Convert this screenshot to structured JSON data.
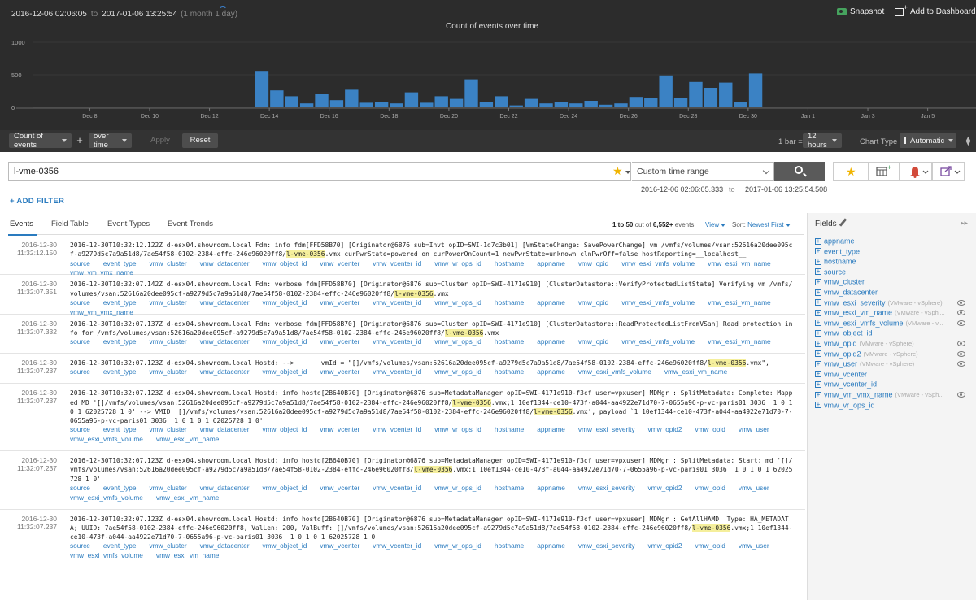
{
  "header": {
    "time_from": "2016-12-06   02:06:05",
    "to_word": "to",
    "time_to": "2017-01-06   13:25:54",
    "duration": "(1 month 1 day)",
    "snapshot_label": "Snapshot",
    "add_dashboard_label": "Add to Dashboard"
  },
  "chart_data": {
    "type": "bar",
    "title": "Count of events over time",
    "xlabel": "",
    "ylabel": "",
    "ylim": [
      0,
      1000
    ],
    "yticks": [
      "0",
      "500",
      "1000"
    ],
    "xticks": [
      "Dec 8",
      "Dec 10",
      "Dec 12",
      "Dec 14",
      "Dec 16",
      "Dec 18",
      "Dec 20",
      "Dec 22",
      "Dec 24",
      "Dec 26",
      "Dec 28",
      "Dec 30",
      "Jan 1",
      "Jan 3",
      "Jan 5"
    ],
    "xlim": [
      "2016-12-06 02:06",
      "2017-01-06 13:25"
    ],
    "bar_width_hours": 12,
    "color": "#3b82c4",
    "x": [
      "2016-12-13 12:00",
      "2016-12-14 00:00",
      "2016-12-14 12:00",
      "2016-12-15 00:00",
      "2016-12-15 12:00",
      "2016-12-16 00:00",
      "2016-12-16 12:00",
      "2016-12-17 00:00",
      "2016-12-17 12:00",
      "2016-12-18 00:00",
      "2016-12-18 12:00",
      "2016-12-19 00:00",
      "2016-12-19 12:00",
      "2016-12-20 00:00",
      "2016-12-20 12:00",
      "2016-12-21 00:00",
      "2016-12-21 12:00",
      "2016-12-22 00:00",
      "2016-12-22 12:00",
      "2016-12-23 00:00",
      "2016-12-23 12:00",
      "2016-12-24 00:00",
      "2016-12-24 12:00",
      "2016-12-25 00:00",
      "2016-12-25 12:00",
      "2016-12-26 00:00",
      "2016-12-26 12:00",
      "2016-12-27 00:00",
      "2016-12-27 12:00",
      "2016-12-28 00:00",
      "2016-12-28 12:00",
      "2016-12-29 00:00",
      "2016-12-29 12:00",
      "2016-12-30 00:00"
    ],
    "values": [
      560,
      260,
      170,
      60,
      200,
      110,
      270,
      70,
      80,
      60,
      230,
      70,
      170,
      130,
      430,
      80,
      170,
      30,
      130,
      60,
      80,
      60,
      100,
      40,
      60,
      160,
      150,
      490,
      140,
      390,
      300,
      380,
      80,
      520,
      110
    ]
  },
  "toolbar": {
    "count_select": "Count of events",
    "plus": "+",
    "overtime_select": "over time",
    "apply_label": "Apply",
    "reset_label": "Reset",
    "bar_label": "1 bar =",
    "bar_select": "12 hours",
    "chart_type_label": "Chart Type",
    "chart_type_select": "Automatic"
  },
  "search": {
    "query": "l-vme-0356",
    "time_range": "Custom time range",
    "from": "2016-12-06 02:06:05.333",
    "to_word": "to",
    "to": "2017-01-06 13:25:54.508"
  },
  "add_filter_label": "+ ADD FILTER",
  "tabs": [
    "Events",
    "Field Table",
    "Event Types",
    "Event Trends"
  ],
  "results": {
    "range": "1 to 50",
    "out_of": "out of",
    "total": "6,552+",
    "events_word": "events",
    "view_label": "View",
    "sort_label": "Sort:",
    "sort_value": "Newest First"
  },
  "events": [
    {
      "date": "2016-12-30",
      "time": "11:32:12.150",
      "msg": "2016-12-30T10:32:12.122Z d-esx04.showroom.local Fdm: info fdm[FFD58B70] [Originator@6876 sub=Invt opID=SWI-1d7c3b01] [VmStateChange::SavePowerChange] vm /vmfs/volumes/vsan:52616a20dee095cf-a9279d5c7a9a51d8/7ae54f58-0102-2384-effc-246e96020ff8/{{l-vme-0356}}.vmx curPwrState=powered on curPowerOnCount=1 newPwrState=unknown clnPwrOff=false hostReporting=__localhost__",
      "fields": [
        "source",
        "event_type",
        "vmw_cluster",
        "vmw_datacenter",
        "vmw_object_id",
        "vmw_vcenter",
        "vmw_vcenter_id",
        "vmw_vr_ops_id",
        "hostname",
        "appname",
        "vmw_opid",
        "vmw_esxi_vmfs_volume",
        "vmw_esxi_vm_name",
        "vmw_vm_vmx_name"
      ]
    },
    {
      "date": "2016-12-30",
      "time": "11:32:07.351",
      "msg": "2016-12-30T10:32:07.142Z d-esx04.showroom.local Fdm: verbose fdm[FFD58B70] [Originator@6876 sub=Cluster opID=SWI-4171e910] [ClusterDatastore::VerifyProtectedListState] Verifying vm /vmfs/volumes/vsan:52616a20dee095cf-a9279d5c7a9a51d8/7ae54f58-0102-2384-effc-246e96020ff8/{{l-vme-0356}}.vmx",
      "fields": [
        "source",
        "event_type",
        "vmw_cluster",
        "vmw_datacenter",
        "vmw_object_id",
        "vmw_vcenter",
        "vmw_vcenter_id",
        "vmw_vr_ops_id",
        "hostname",
        "appname",
        "vmw_opid",
        "vmw_esxi_vmfs_volume",
        "vmw_esxi_vm_name",
        "vmw_vm_vmx_name"
      ]
    },
    {
      "date": "2016-12-30",
      "time": "11:32:07.332",
      "msg": "2016-12-30T10:32:07.137Z d-esx04.showroom.local Fdm: verbose fdm[FFD58B70] [Originator@6876 sub=Cluster opID=SWI-4171e910] [ClusterDatastore::ReadProtectedListFromVSan] Read protection info for /vmfs/volumes/vsan:52616a20dee095cf-a9279d5c7a9a51d8/7ae54f58-0102-2384-effc-246e96020ff8/{{l-vme-0356}}.vmx",
      "fields": [
        "source",
        "event_type",
        "vmw_cluster",
        "vmw_datacenter",
        "vmw_object_id",
        "vmw_vcenter",
        "vmw_vcenter_id",
        "vmw_vr_ops_id",
        "hostname",
        "appname",
        "vmw_opid",
        "vmw_esxi_vmfs_volume",
        "vmw_esxi_vm_name"
      ]
    },
    {
      "date": "2016-12-30",
      "time": "11:32:07.237",
      "msg": "2016-12-30T10:32:07.123Z d-esx04.showroom.local Hostd: -->       vmId = \"[]/vmfs/volumes/vsan:52616a20dee095cf-a9279d5c7a9a51d8/7ae54f58-0102-2384-effc-246e96020ff8/{{l-vme-0356}}.vmx\",",
      "fields": [
        "source",
        "event_type",
        "vmw_cluster",
        "vmw_datacenter",
        "vmw_object_id",
        "vmw_vcenter",
        "vmw_vcenter_id",
        "vmw_vr_ops_id",
        "hostname",
        "appname",
        "vmw_esxi_vmfs_volume",
        "vmw_esxi_vm_name"
      ]
    },
    {
      "date": "2016-12-30",
      "time": "11:32:07.237",
      "msg": "2016-12-30T10:32:07.123Z d-esx04.showroom.local Hostd: info hostd[2B640B70] [Originator@6876 sub=MetadataManager opID=SWI-4171e910-f3cf user=vpxuser] MDMgr : SplitMetadata: Complete: Mapped MD '[]/vmfs/volumes/vsan:52616a20dee095cf-a9279d5c7a9a51d8/7ae54f58-0102-2384-effc-246e96020ff8/{{l-vme-0356}}.vmx;1 10ef1344-ce10-473f-a044-aa4922e71d70-7-0655a96-p-vc-paris01 3036  1 0 1 0 1 62025728 1 0' --> VMID '[]/vmfs/volumes/vsan:52616a20dee095cf-a9279d5c7a9a51d8/7ae54f58-0102-2384-effc-246e96020ff8/{{l-vme-0356}}.vmx', payload `1 10ef1344-ce10-473f-a044-aa4922e71d70-7-0655a96-p-vc-paris01 3036  1 0 1 0 1 62025728 1 0'",
      "fields": [
        "source",
        "event_type",
        "vmw_cluster",
        "vmw_datacenter",
        "vmw_object_id",
        "vmw_vcenter",
        "vmw_vcenter_id",
        "vmw_vr_ops_id",
        "hostname",
        "appname",
        "vmw_esxi_severity",
        "vmw_opid2",
        "vmw_opid",
        "vmw_user",
        "vmw_esxi_vmfs_volume",
        "vmw_esxi_vm_name"
      ]
    },
    {
      "date": "2016-12-30",
      "time": "11:32:07.237",
      "msg": "2016-12-30T10:32:07.123Z d-esx04.showroom.local Hostd: info hostd[2B640B70] [Originator@6876 sub=MetadataManager opID=SWI-4171e910-f3cf user=vpxuser] MDMgr : SplitMetadata: Start: md '[]/vmfs/volumes/vsan:52616a20dee095cf-a9279d5c7a9a51d8/7ae54f58-0102-2384-effc-246e96020ff8/{{l-vme-0356}}.vmx;1 10ef1344-ce10-473f-a044-aa4922e71d70-7-0655a96-p-vc-paris01 3036  1 0 1 0 1 62025728 1 0'",
      "fields": [
        "source",
        "event_type",
        "vmw_cluster",
        "vmw_datacenter",
        "vmw_object_id",
        "vmw_vcenter",
        "vmw_vcenter_id",
        "vmw_vr_ops_id",
        "hostname",
        "appname",
        "vmw_esxi_severity",
        "vmw_opid2",
        "vmw_opid",
        "vmw_user",
        "vmw_esxi_vmfs_volume",
        "vmw_esxi_vm_name"
      ]
    },
    {
      "date": "2016-12-30",
      "time": "11:32:07.237",
      "msg": "2016-12-30T10:32:07.123Z d-esx04.showroom.local Hostd: info hostd[2B640B70] [Originator@6876 sub=MetadataManager opID=SWI-4171e910-f3cf user=vpxuser] MDMgr : GetAllHAMD: Type: HA_METADATA; UUID: 7ae54f58-0102-2384-effc-246e96020ff8, ValLen: 200, ValBuff: []/vmfs/volumes/vsan:52616a20dee095cf-a9279d5c7a9a51d8/7ae54f58-0102-2384-effc-246e96020ff8/{{l-vme-0356}}.vmx;1 10ef1344-ce10-473f-a044-aa4922e71d70-7-0655a96-p-vc-paris01 3036  1 0 1 0 1 62025728 1 0",
      "fields": [
        "source",
        "event_type",
        "vmw_cluster",
        "vmw_datacenter",
        "vmw_object_id",
        "vmw_vcenter",
        "vmw_vcenter_id",
        "vmw_vr_ops_id",
        "hostname",
        "appname",
        "vmw_esxi_severity",
        "vmw_opid2",
        "vmw_opid",
        "vmw_user",
        "vmw_esxi_vmfs_volume",
        "vmw_esxi_vm_name"
      ]
    }
  ],
  "fields_panel": {
    "title": "Fields",
    "expand": "▸▸",
    "items": [
      {
        "name": "appname",
        "src": "",
        "eye": false
      },
      {
        "name": "event_type",
        "src": "",
        "eye": false
      },
      {
        "name": "hostname",
        "src": "",
        "eye": false
      },
      {
        "name": "source",
        "src": "",
        "eye": false
      },
      {
        "name": "vmw_cluster",
        "src": "",
        "eye": false
      },
      {
        "name": "vmw_datacenter",
        "src": "",
        "eye": false
      },
      {
        "name": "vmw_esxi_severity",
        "src": "(VMware - vSphere)",
        "eye": true
      },
      {
        "name": "vmw_esxi_vm_name",
        "src": "(VMware - vSphi...",
        "eye": true
      },
      {
        "name": "vmw_esxi_vmfs_volume",
        "src": "(VMware - v...",
        "eye": true
      },
      {
        "name": "vmw_object_id",
        "src": "",
        "eye": false
      },
      {
        "name": "vmw_opid",
        "src": "(VMware - vSphere)",
        "eye": true
      },
      {
        "name": "vmw_opid2",
        "src": "(VMware - vSphere)",
        "eye": true
      },
      {
        "name": "vmw_user",
        "src": "(VMware - vSphere)",
        "eye": true
      },
      {
        "name": "vmw_vcenter",
        "src": "",
        "eye": false
      },
      {
        "name": "vmw_vcenter_id",
        "src": "",
        "eye": false
      },
      {
        "name": "vmw_vm_vmx_name",
        "src": "(VMware - vSph...",
        "eye": true
      },
      {
        "name": "vmw_vr_ops_id",
        "src": "",
        "eye": false
      }
    ]
  }
}
